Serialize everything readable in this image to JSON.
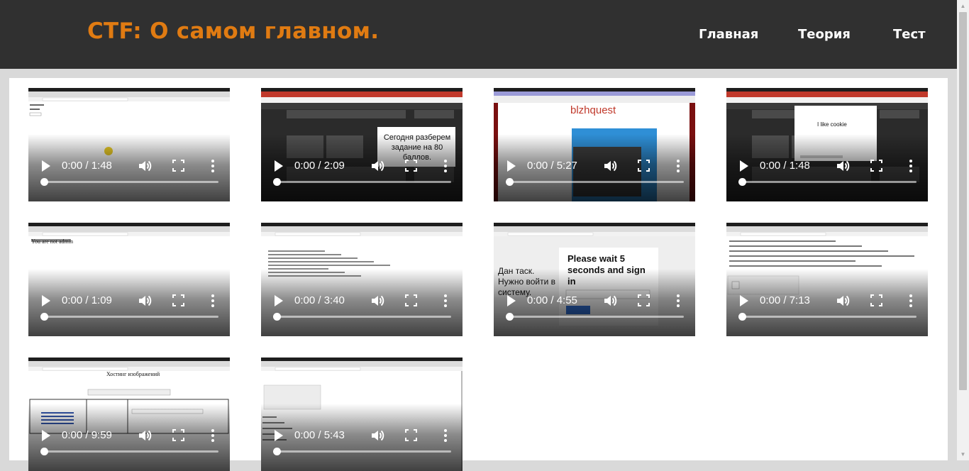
{
  "header": {
    "title": "CTF: О самом главном.",
    "nav": [
      "Главная",
      "Теория",
      "Тест"
    ],
    "background": "#303030",
    "title_color": "#e07b12"
  },
  "videos": [
    {
      "time": "0:00 / 1:48",
      "overlay_text": ""
    },
    {
      "time": "0:00 / 2:09",
      "overlay_text": "Сегодня разберем задание на 80 баллов."
    },
    {
      "time": "0:00 / 5:27",
      "overlay_text": "blzhquest"
    },
    {
      "time": "0:00 / 1:48",
      "overlay_text": "I like cookie"
    },
    {
      "time": "0:00 / 1:09",
      "overlay_text": "You are not admin"
    },
    {
      "time": "0:00 / 3:40",
      "overlay_text": ""
    },
    {
      "time": "0:00 / 4:55",
      "overlay_text": "Please wait 5 seconds and sign in",
      "side_text": "Дан таск. Нужно войти в систему."
    },
    {
      "time": "0:00 / 7:13",
      "overlay_text": ""
    },
    {
      "time": "0:00 / 9:59",
      "overlay_text": "Хостинг изображений"
    },
    {
      "time": "0:00 / 5:43",
      "overlay_text": ""
    }
  ],
  "icons": {
    "play": "play-icon",
    "volume": "volume-icon",
    "fullscreen": "fullscreen-icon",
    "more": "more-options-icon"
  }
}
